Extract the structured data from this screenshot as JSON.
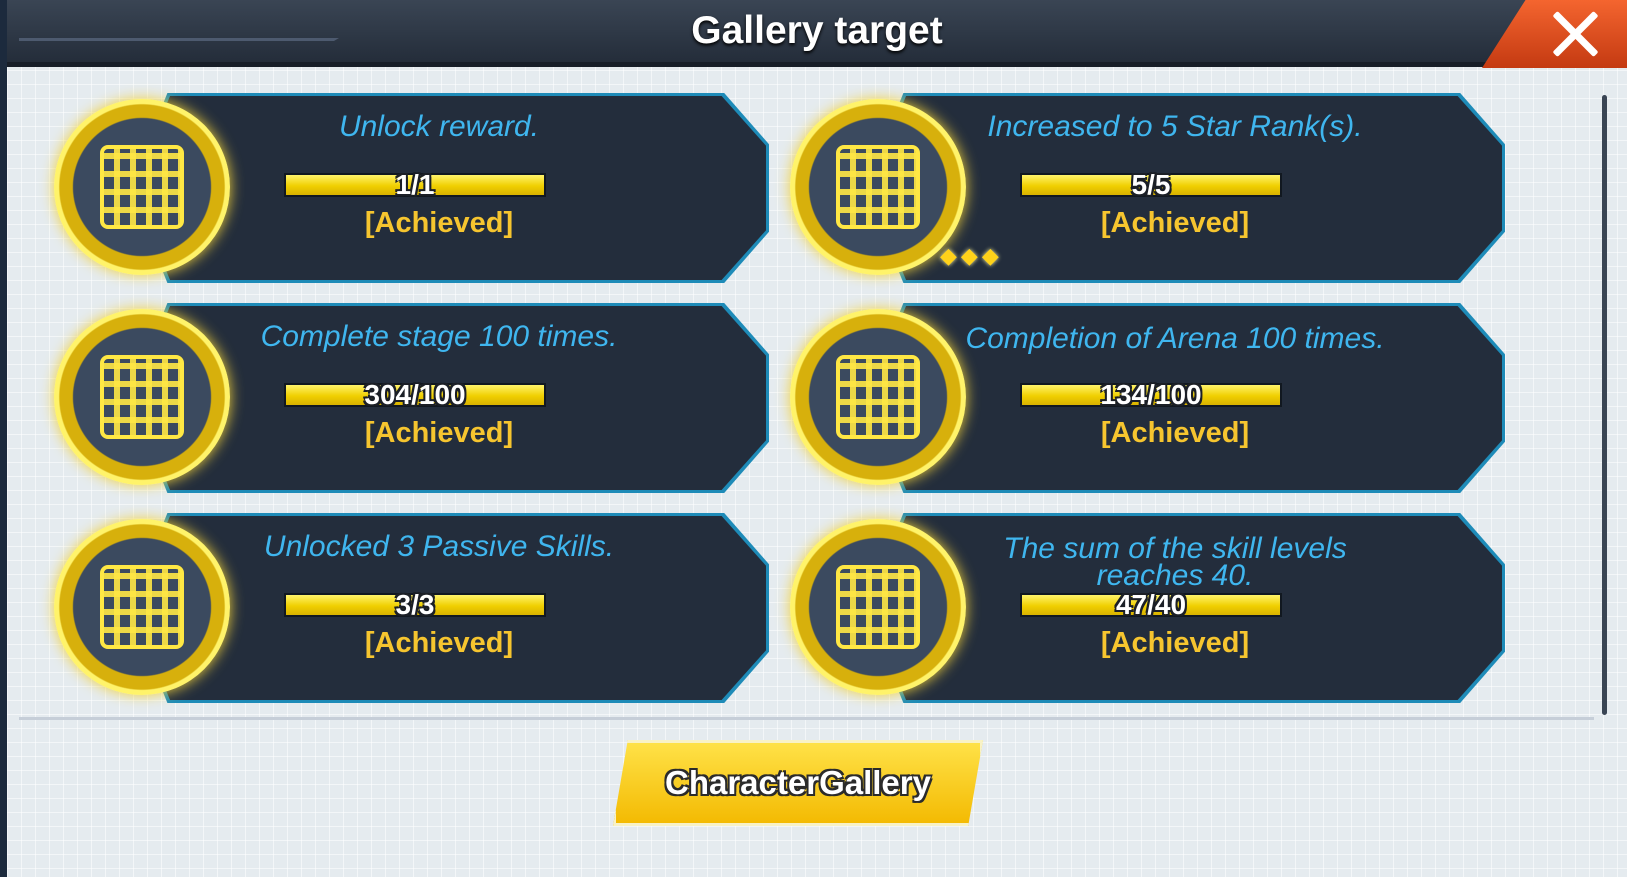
{
  "dialog": {
    "title": "Gallery target",
    "close_icon": "close-icon",
    "button_label": "CharacterGallery"
  },
  "colors": {
    "accent_yellow": "#f6c52f",
    "task_blue": "#3fb6ef",
    "close_red": "#e5501f",
    "card_bg": "#232d3c"
  },
  "targets": [
    {
      "text": "Unlock reward.",
      "progress": "1/1",
      "fraction": 1.0,
      "status": "[Achieved]",
      "icon": "gold-medal-icon"
    },
    {
      "text": "Increased to 5 Star Rank(s).",
      "progress": "5/5",
      "fraction": 1.0,
      "status": "[Achieved]",
      "icon": "gold-medal-icon"
    },
    {
      "text": "Complete stage 100 times.",
      "progress": "304/100",
      "fraction": 1.0,
      "status": "[Achieved]",
      "icon": "gold-medal-icon"
    },
    {
      "text": "Completion of Arena 100 times.",
      "progress": "134/100",
      "fraction": 1.0,
      "status": "[Achieved]",
      "icon": "gold-medal-icon"
    },
    {
      "text": "Unlocked 3 Passive Skills.",
      "progress": "3/3",
      "fraction": 1.0,
      "status": "[Achieved]",
      "icon": "gold-medal-icon"
    },
    {
      "text": "The sum of the skill levels reaches 40.",
      "progress": "47/40",
      "fraction": 1.0,
      "status": "[Achieved]",
      "icon": "gold-medal-icon"
    }
  ]
}
